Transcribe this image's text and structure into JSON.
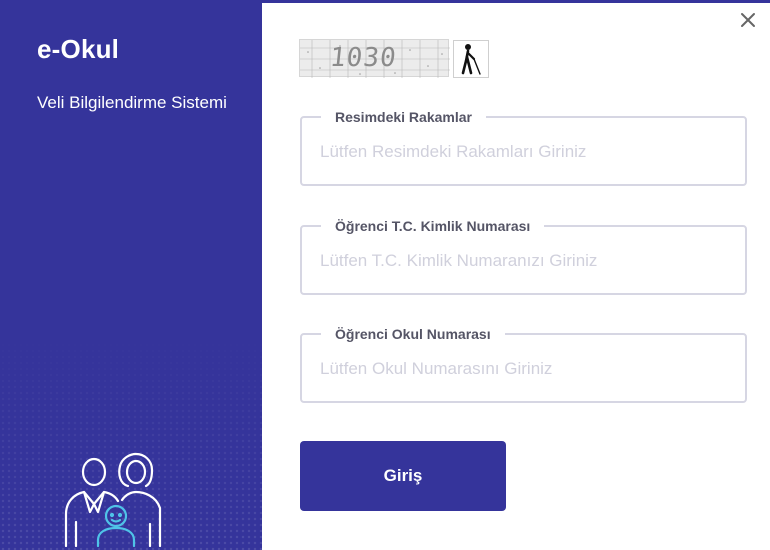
{
  "sidebar": {
    "title": "e-Okul",
    "subtitle": "Veli Bilgilendirme Sistemi",
    "illustration_icon": "family-icon"
  },
  "captcha": {
    "code": "1030",
    "accessibility_icon": "blind-person-icon"
  },
  "form": {
    "fields": [
      {
        "label": "Resimdeki Rakamlar",
        "placeholder": "Lütfen Resimdeki Rakamları Giriniz",
        "value": ""
      },
      {
        "label": "Öğrenci T.C. Kimlik Numarası",
        "placeholder": "Lütfen T.C. Kimlik Numaranızı Giriniz",
        "value": ""
      },
      {
        "label": "Öğrenci Okul Numarası",
        "placeholder": "Lütfen Okul Numarasını Giriniz",
        "value": ""
      }
    ],
    "submit_label": "Giriş"
  },
  "colors": {
    "brand": "#35349b",
    "icon_accent": "#4fc3e8",
    "field_border": "#d6d6e3",
    "placeholder": "#d0d0dc"
  }
}
